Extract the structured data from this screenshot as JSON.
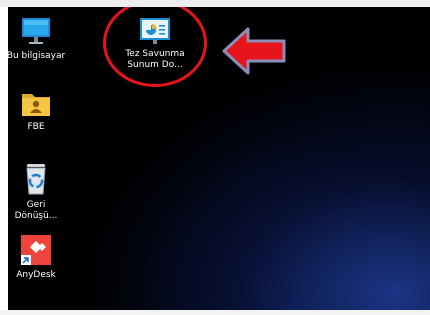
{
  "desktop": {
    "icons": [
      {
        "name": "this-pc",
        "label": "Bu bilgisayar"
      },
      {
        "name": "fbe-folder",
        "label": "FBE"
      },
      {
        "name": "recycle-bin",
        "label": "Geri Dönüşü..."
      },
      {
        "name": "anydesk",
        "label": "AnyDesk"
      },
      {
        "name": "presentation-file",
        "label": "Tez Savunma Sunum Do..."
      }
    ]
  },
  "annotation": {
    "circle_color": "#e8141b",
    "arrow_color": "#e8141b",
    "arrow_outline": "#8a8fb8"
  }
}
